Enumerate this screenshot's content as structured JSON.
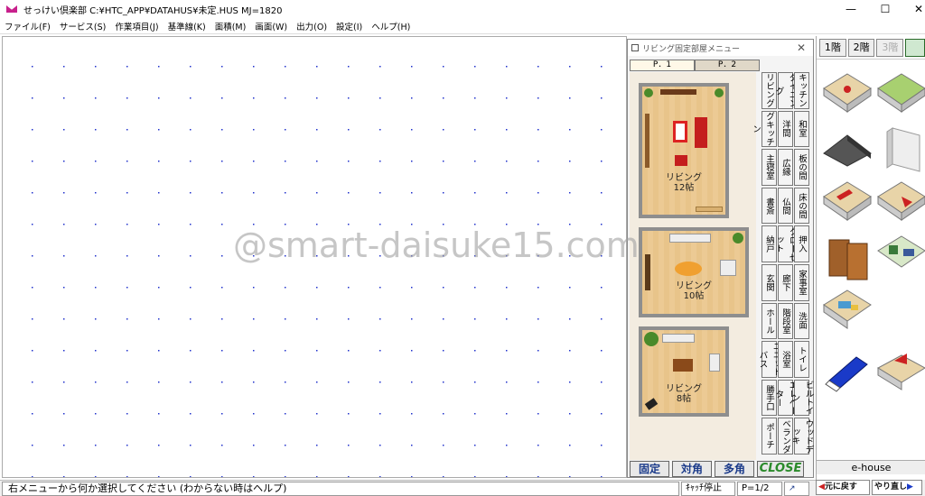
{
  "window": {
    "title": "せっけい倶楽部 C:¥HTC_APP¥DATAHUS¥未定.HUS  MJ=1820",
    "min_icon": "minimize-icon",
    "max_icon": "maximize-icon",
    "close_icon": "close-icon"
  },
  "menu": [
    "ファイル(F)",
    "サービス(S)",
    "作業項目(J)",
    "基準線(K)",
    "面積(M)",
    "画面(W)",
    "出力(O)",
    "設定(I)",
    "ヘルプ(H)"
  ],
  "watermark": "@smart-daisuke15.com",
  "status": {
    "message": "右メニューから何か選択してください (わからない時はヘルプ)",
    "snap": "ｷｬｯﾁ停止",
    "page": "P=1/2"
  },
  "panel": {
    "title": "リビング固定部屋メニュー",
    "tabs": [
      "P．1",
      "P．2"
    ],
    "plans": [
      {
        "label": "リビング",
        "size": "12帖"
      },
      {
        "label": "リビング",
        "size": "10帖"
      },
      {
        "label": "リビング",
        "size": "8帖"
      }
    ],
    "categories": [
      [
        "リビング",
        "ダイニング",
        "キッチン"
      ],
      [
        "ダイニングキッチン",
        "洋間",
        "和室"
      ],
      [
        "主寝室",
        "広縁",
        "板の間"
      ],
      [
        "書斎",
        "仏間",
        "床の間"
      ],
      [
        "納戸",
        "クローゼット",
        "押入"
      ],
      [
        "玄関",
        "廊下",
        "家事室"
      ],
      [
        "ホール",
        "階段室",
        "洗面"
      ],
      [
        "ユニットバス",
        "浴室",
        "トイレ"
      ],
      [
        "勝手口",
        "エレベーター",
        "ビルトイン"
      ],
      [
        "ポーチ",
        "ベランダ",
        "ウッドデッキ"
      ]
    ],
    "buttons": {
      "fixed": "固定",
      "diagonal": "対角",
      "polygon": "多角",
      "close": "CLOSE"
    }
  },
  "sidebar": {
    "floors": [
      "1階",
      "2階",
      "3階"
    ],
    "brand": "e-house",
    "undo": "元に戻す",
    "redo": "やり直し"
  }
}
